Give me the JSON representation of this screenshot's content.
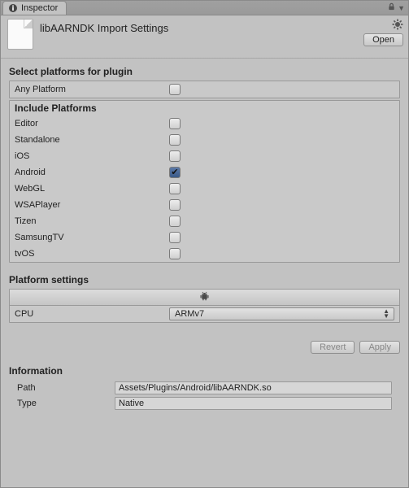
{
  "tab": {
    "label": "Inspector"
  },
  "header": {
    "title": "libAARNDK Import Settings",
    "open_label": "Open"
  },
  "platforms": {
    "heading": "Select platforms for plugin",
    "any_label": "Any Platform",
    "any_checked": false,
    "include_heading": "Include Platforms",
    "items": [
      {
        "label": "Editor",
        "checked": false
      },
      {
        "label": "Standalone",
        "checked": false
      },
      {
        "label": "iOS",
        "checked": false
      },
      {
        "label": "Android",
        "checked": true
      },
      {
        "label": "WebGL",
        "checked": false
      },
      {
        "label": "WSAPlayer",
        "checked": false
      },
      {
        "label": "Tizen",
        "checked": false
      },
      {
        "label": "SamsungTV",
        "checked": false
      },
      {
        "label": "tvOS",
        "checked": false
      }
    ]
  },
  "platform_settings": {
    "heading": "Platform settings",
    "active_tab_icon": "android",
    "cpu_label": "CPU",
    "cpu_value": "ARMv7"
  },
  "actions": {
    "revert_label": "Revert",
    "apply_label": "Apply"
  },
  "information": {
    "heading": "Information",
    "path_label": "Path",
    "path_value": "Assets/Plugins/Android/libAARNDK.so",
    "type_label": "Type",
    "type_value": "Native"
  }
}
